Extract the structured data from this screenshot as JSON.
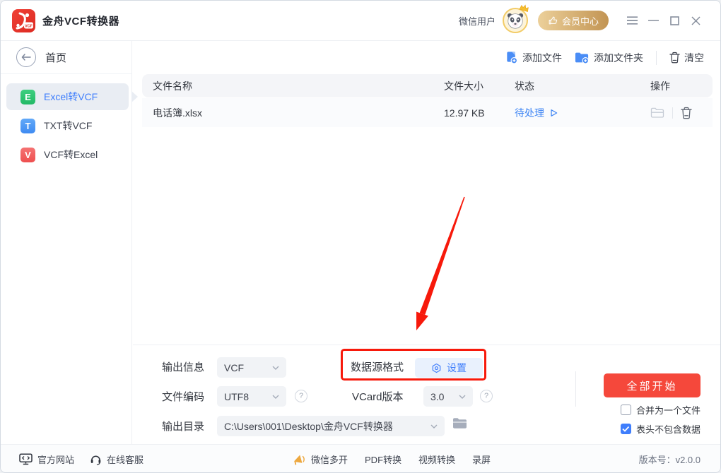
{
  "titlebar": {
    "app_title": "金舟VCF转换器",
    "user_label": "微信用户",
    "member_center_label": "会员中心",
    "logo_text": "VCF"
  },
  "sidebar": {
    "home_label": "首页",
    "items": [
      {
        "badge": "E",
        "label": "Excel转VCF",
        "active": true
      },
      {
        "badge": "T",
        "label": "TXT转VCF",
        "active": false
      },
      {
        "badge": "V",
        "label": "VCF转Excel",
        "active": false
      }
    ]
  },
  "toolbar": {
    "add_file_label": "添加文件",
    "add_folder_label": "添加文件夹",
    "clear_label": "清空"
  },
  "table": {
    "headers": [
      "文件名称",
      "文件大小",
      "状态",
      "操作"
    ],
    "rows": [
      {
        "name": "电话簿.xlsx",
        "size": "12.97 KB",
        "status": "待处理"
      }
    ]
  },
  "settings": {
    "output_info_label": "输出信息",
    "output_info_value": "VCF",
    "encoding_label": "文件编码",
    "encoding_value": "UTF8",
    "output_dir_label": "输出目录",
    "output_dir_value": "C:\\Users\\001\\Desktop\\金舟VCF转换器",
    "datasource_label": "数据源格式",
    "datasource_button_label": "设置",
    "vcard_label": "VCard版本",
    "vcard_value": "3.0",
    "help_glyph": "?"
  },
  "actions": {
    "start_all_label": "全部开始",
    "merge_label": "合并为一个文件",
    "merge_checked": false,
    "header_label": "表头不包含数据",
    "header_checked": true
  },
  "footer": {
    "official_site": "官方网站",
    "online_service": "在线客服",
    "wechat_multi": "微信多开",
    "pdf_convert": "PDF转换",
    "video_convert": "视频转换",
    "screen_record": "录屏",
    "version": "版本号：v2.0.0"
  },
  "colors": {
    "accent_blue": "#3f7efc",
    "status_blue": "#4086f4",
    "start_red": "#f5483b",
    "annotation_red": "#f7190b",
    "member_gold": "#c29453",
    "badge_green": "#23b966",
    "badge_blue": "#3f8bf2",
    "badge_red": "#ee4f4f"
  }
}
